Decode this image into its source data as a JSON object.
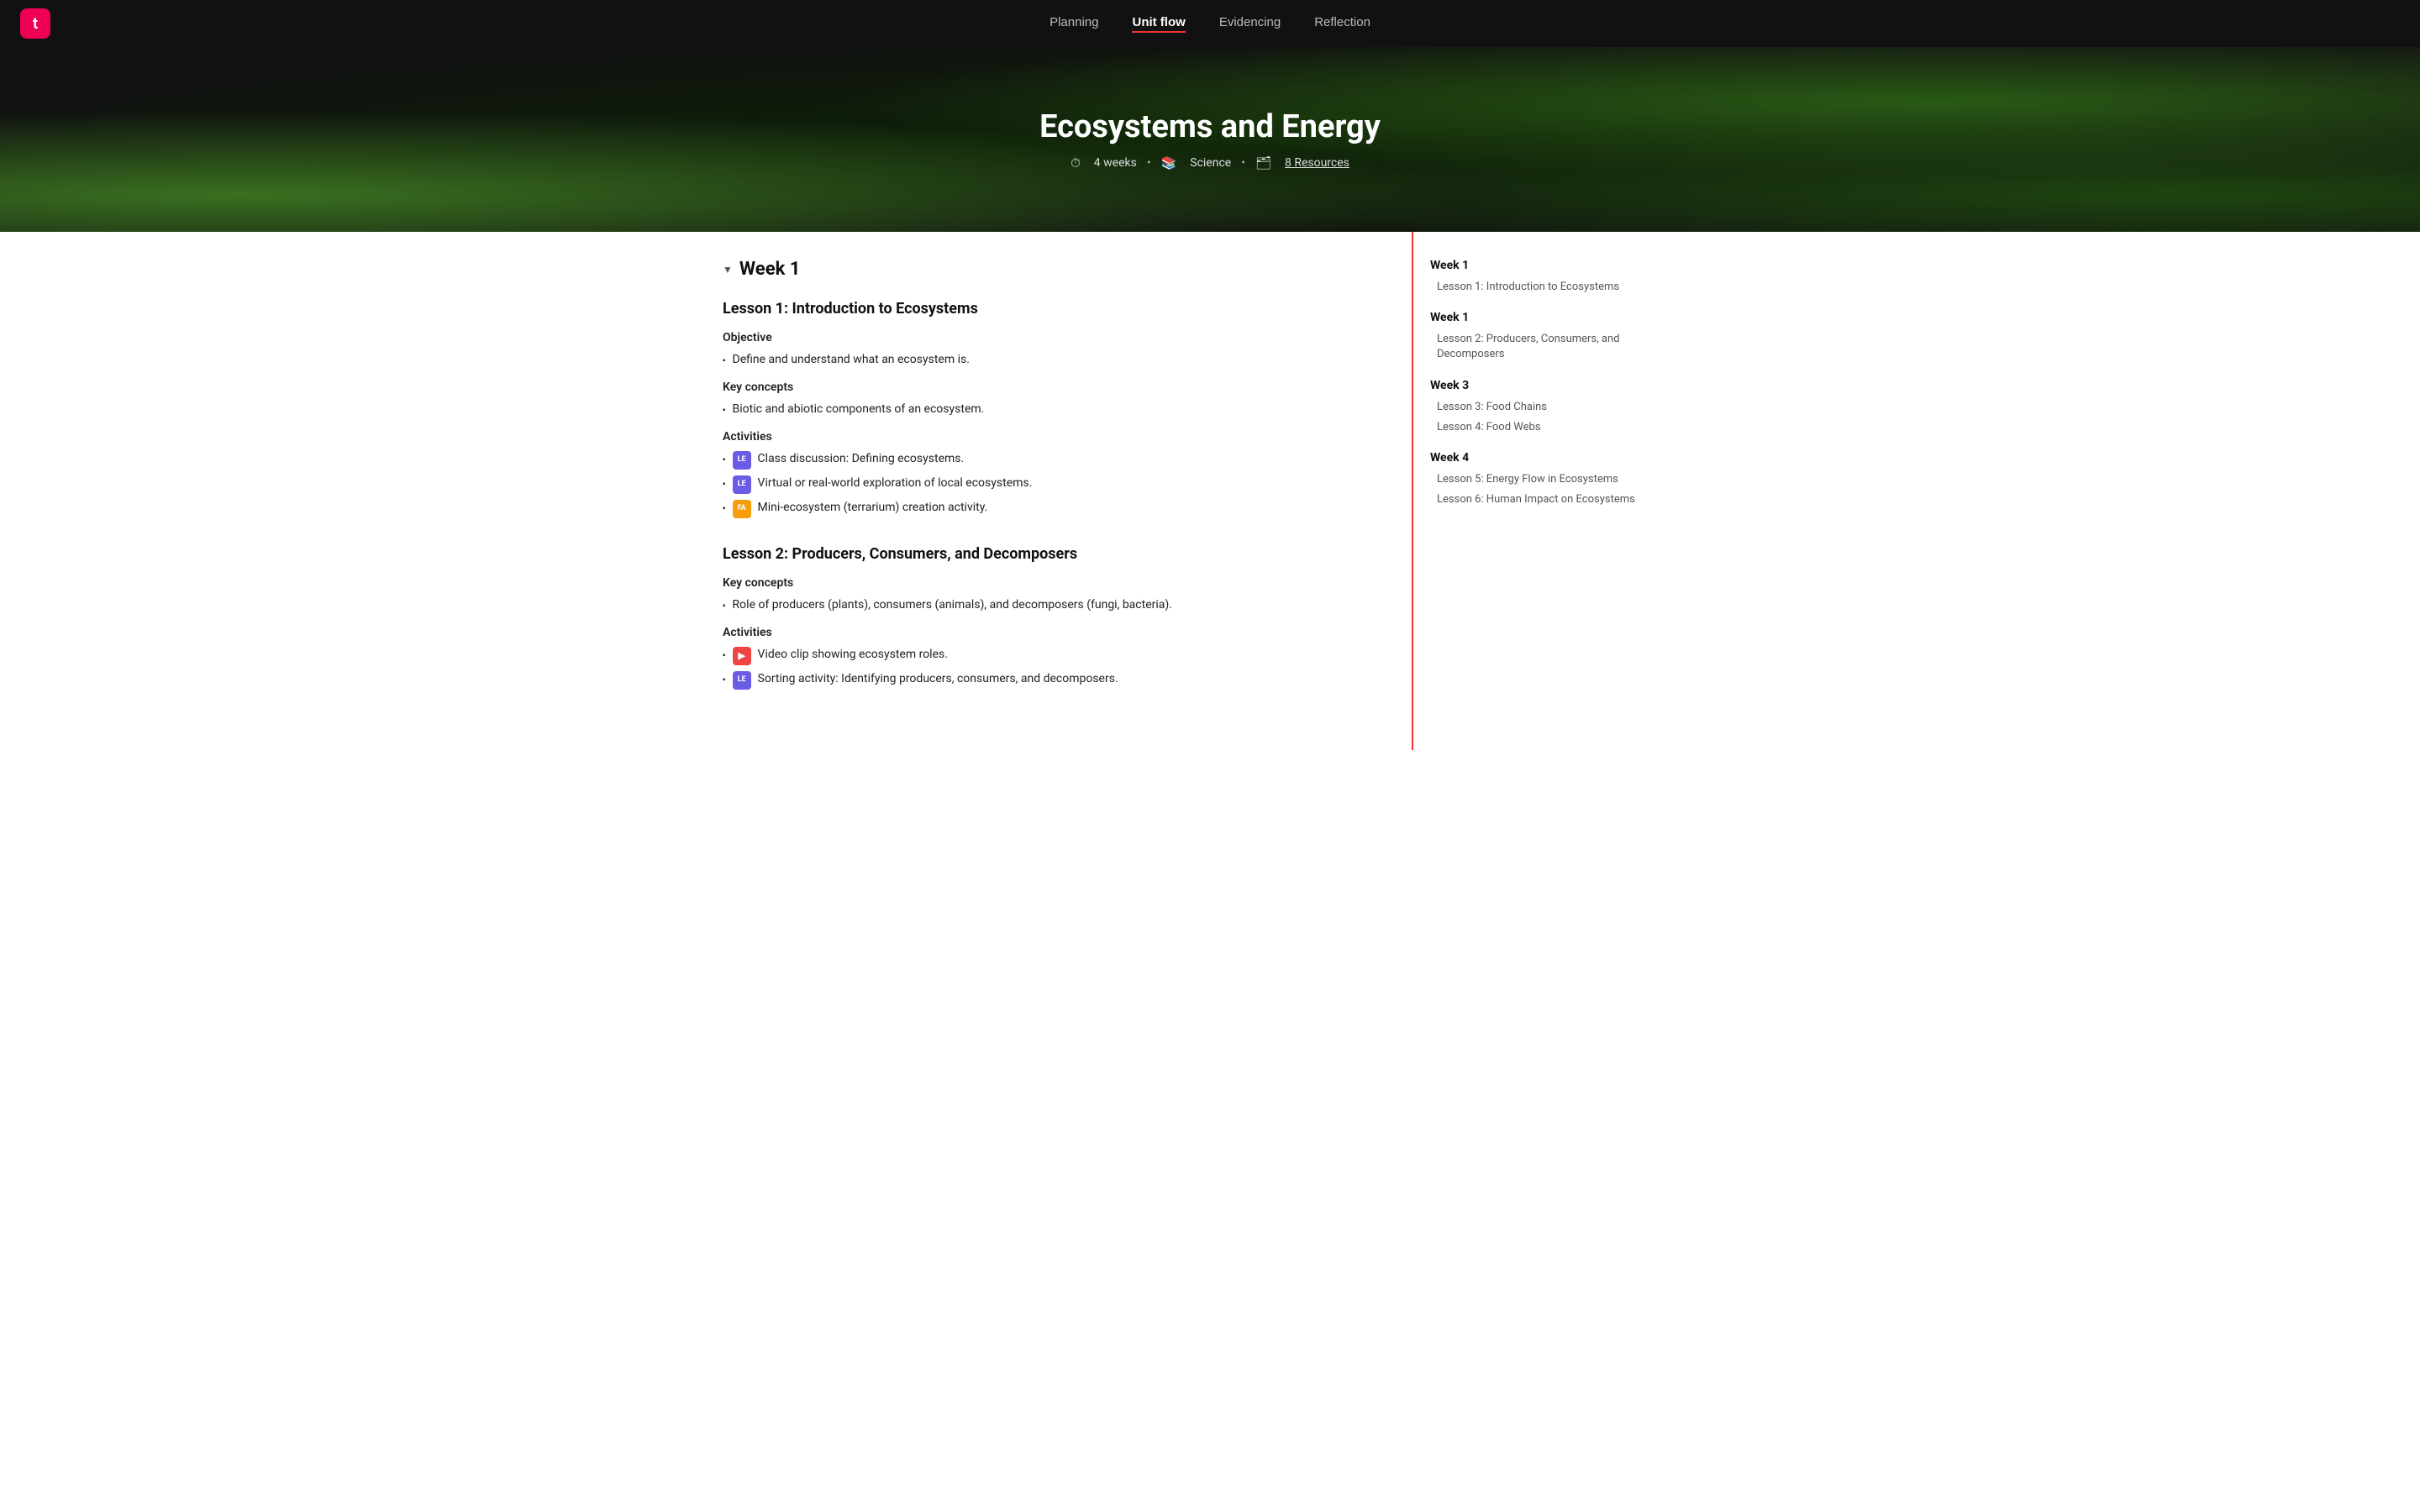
{
  "app": {
    "logo_letter": "t"
  },
  "nav": {
    "tabs": [
      {
        "id": "planning",
        "label": "Planning",
        "active": false
      },
      {
        "id": "unit-flow",
        "label": "Unit flow",
        "active": true
      },
      {
        "id": "evidencing",
        "label": "Evidencing",
        "active": false
      },
      {
        "id": "reflection",
        "label": "Reflection",
        "active": false
      }
    ]
  },
  "hero": {
    "title": "Ecosystems and Energy",
    "meta": {
      "duration": "4 weeks",
      "subject": "Science",
      "resources_label": "8 Resources"
    }
  },
  "week1": {
    "label": "Week 1",
    "lessons": [
      {
        "title": "Lesson 1: Introduction to Ecosystems",
        "sections": [
          {
            "label": "Objective",
            "items": [
              {
                "text": "Define and understand what an ecosystem is.",
                "badge": null
              }
            ]
          },
          {
            "label": "Key concepts",
            "items": [
              {
                "text": "Biotic and abiotic components of an ecosystem.",
                "badge": null
              }
            ]
          },
          {
            "label": "Activities",
            "items": [
              {
                "text": "Class discussion: Defining ecosystems.",
                "badge": "LE",
                "badge_type": "le"
              },
              {
                "text": "Virtual or real-world exploration of local ecosystems.",
                "badge": "LE",
                "badge_type": "le"
              },
              {
                "text": "Mini-ecosystem (terrarium) creation activity.",
                "badge": "FA",
                "badge_type": "fa"
              }
            ]
          }
        ]
      },
      {
        "title": "Lesson 2: Producers, Consumers, and Decomposers",
        "sections": [
          {
            "label": "Key concepts",
            "items": [
              {
                "text": "Role of producers (plants), consumers (animals), and decomposers (fungi, bacteria).",
                "badge": null
              }
            ]
          },
          {
            "label": "Activities",
            "items": [
              {
                "text": "Video clip showing ecosystem roles.",
                "badge": "▶",
                "badge_type": "video"
              },
              {
                "text": "Sorting activity: Identifying producers, consumers, and decomposers.",
                "badge": "LE",
                "badge_type": "le"
              }
            ]
          }
        ]
      }
    ]
  },
  "sidebar": {
    "weeks": [
      {
        "label": "Week 1",
        "lessons": [
          {
            "label": "Lesson 1: Introduction to Ecosystems"
          }
        ]
      },
      {
        "label": "Week 1",
        "lessons": [
          {
            "label": "Lesson 2: Producers, Consumers, and Decomposers"
          }
        ]
      },
      {
        "label": "Week 3",
        "lessons": [
          {
            "label": "Lesson 3: Food Chains"
          },
          {
            "label": "Lesson 4: Food Webs"
          }
        ]
      },
      {
        "label": "Week 4",
        "lessons": [
          {
            "label": "Lesson 5: Energy Flow in Ecosystems"
          },
          {
            "label": "Lesson 6: Human Impact on Ecosystems"
          }
        ]
      }
    ]
  }
}
